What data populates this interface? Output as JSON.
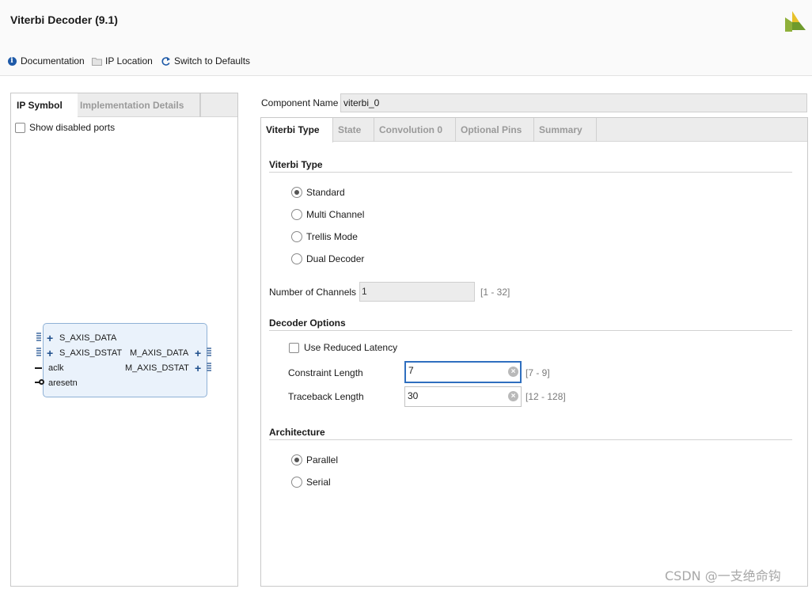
{
  "header": {
    "title": "Viterbi Decoder (9.1)",
    "logo_icon": "xilinx-logo-icon",
    "toolbar": {
      "documentation": "Documentation",
      "ip_location": "IP Location",
      "switch_defaults": "Switch to Defaults"
    }
  },
  "left_panel": {
    "tabs": [
      {
        "label": "IP Symbol",
        "active": true
      },
      {
        "label": "Implementation Details",
        "active": false
      }
    ],
    "show_disabled_ports": {
      "label": "Show disabled ports",
      "checked": false
    },
    "ip_symbol": {
      "inputs": [
        "S_AXIS_DATA",
        "S_AXIS_DSTAT",
        "aclk",
        "aresetn"
      ],
      "outputs": [
        "M_AXIS_DATA",
        "M_AXIS_DSTAT"
      ]
    }
  },
  "component_name": {
    "label": "Component Name",
    "value": "viterbi_0"
  },
  "right_panel": {
    "tabs": [
      {
        "label": "Viterbi Type",
        "active": true
      },
      {
        "label": "State",
        "active": false
      },
      {
        "label": "Convolution 0",
        "active": false
      },
      {
        "label": "Optional Pins",
        "active": false
      },
      {
        "label": "Summary",
        "active": false
      }
    ],
    "viterbi_type": {
      "title": "Viterbi Type",
      "options": [
        {
          "label": "Standard",
          "selected": true
        },
        {
          "label": "Multi Channel",
          "selected": false
        },
        {
          "label": "Trellis Mode",
          "selected": false
        },
        {
          "label": "Dual Decoder",
          "selected": false
        }
      ]
    },
    "channels": {
      "label": "Number of Channels",
      "value": "1",
      "range": "[1 - 32]"
    },
    "decoder_options": {
      "title": "Decoder Options",
      "reduced_latency": {
        "label": "Use Reduced Latency",
        "checked": false
      },
      "constraint_length": {
        "label": "Constraint Length",
        "value": "7",
        "range": "[7 - 9]"
      },
      "traceback_length": {
        "label": "Traceback Length",
        "value": "30",
        "range": "[12 - 128]"
      }
    },
    "architecture": {
      "title": "Architecture",
      "options": [
        {
          "label": "Parallel",
          "selected": true
        },
        {
          "label": "Serial",
          "selected": false
        }
      ]
    }
  },
  "watermark": "CSDN @一支绝命钩"
}
